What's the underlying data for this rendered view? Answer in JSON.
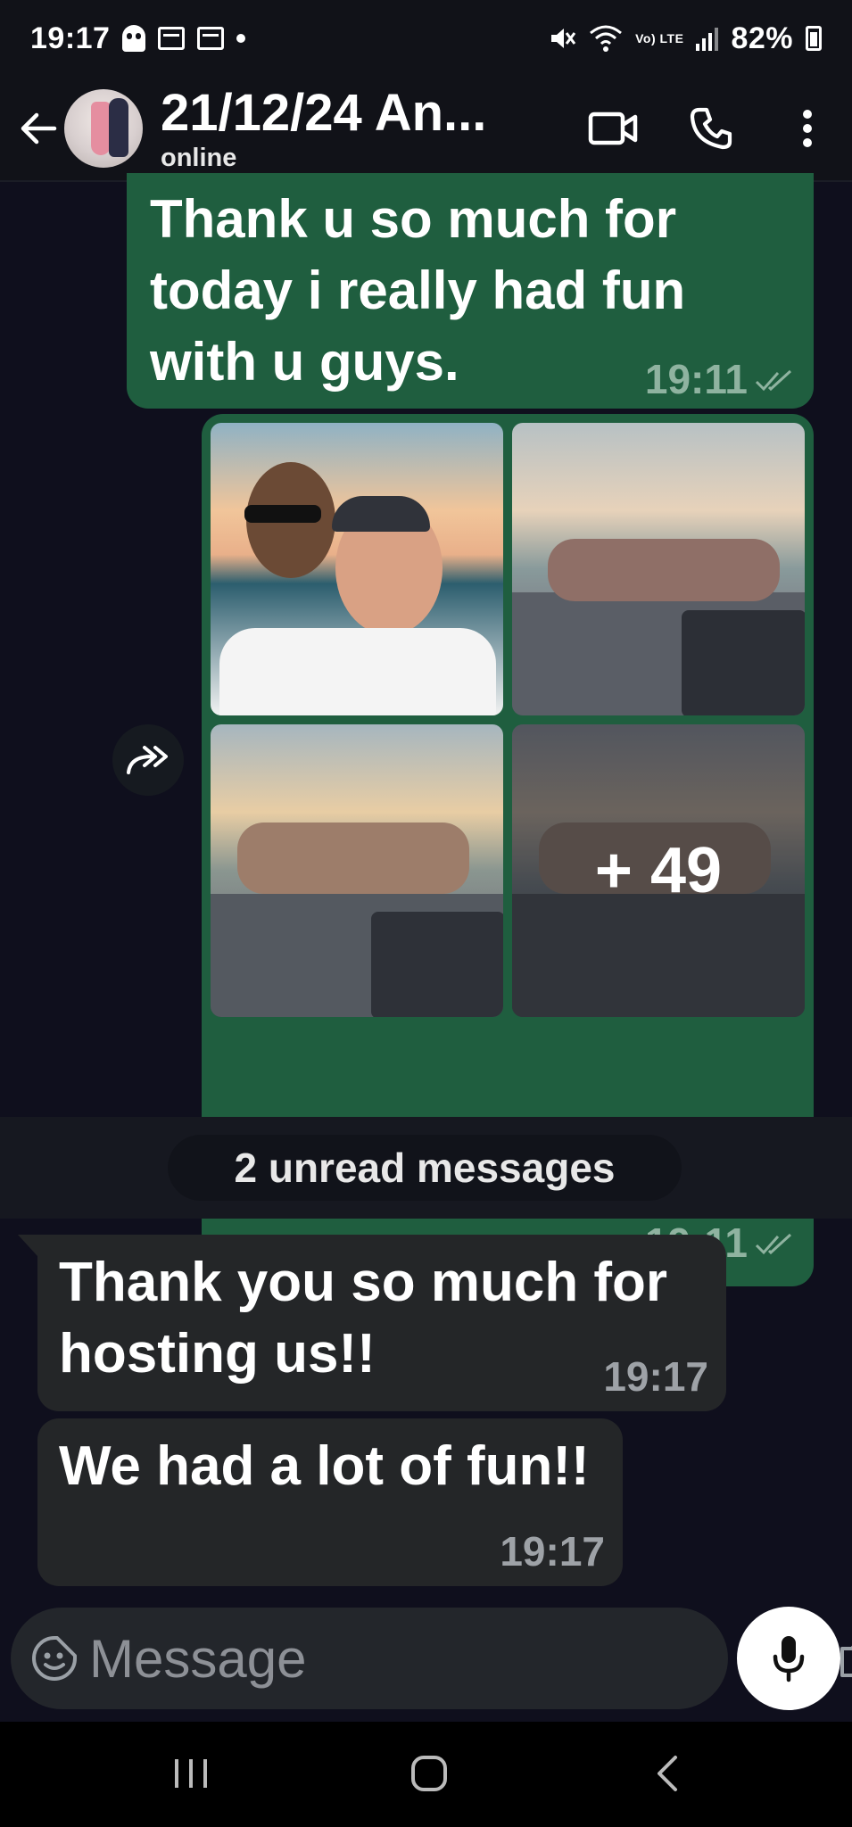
{
  "status_bar": {
    "time": "19:17",
    "battery": "82%",
    "network_label": "Vo) LTE"
  },
  "header": {
    "contact_name": "21/12/24 An...",
    "contact_status": "online",
    "icons": [
      "back-arrow-icon",
      "video-call-icon",
      "phone-icon",
      "more-vert-icon"
    ]
  },
  "messages": {
    "outgoing_text": {
      "text": "Thank u so much for today i really had fun with u guys.",
      "time": "19:11"
    },
    "outgoing_media": {
      "photo_count": 4,
      "more_count": "+ 49",
      "time": "19:11"
    },
    "unread_divider": "2 unread messages",
    "incoming": [
      {
        "text": "Thank you so much for hosting us!!",
        "time": "19:17"
      },
      {
        "text": "We had a lot of fun!!",
        "time": "19:17"
      }
    ]
  },
  "composer": {
    "placeholder": "Message",
    "value": ""
  },
  "colors": {
    "outgoing_bubble": "#1f5e3f",
    "incoming_bubble": "#242628",
    "background": "#0f0f1d"
  }
}
